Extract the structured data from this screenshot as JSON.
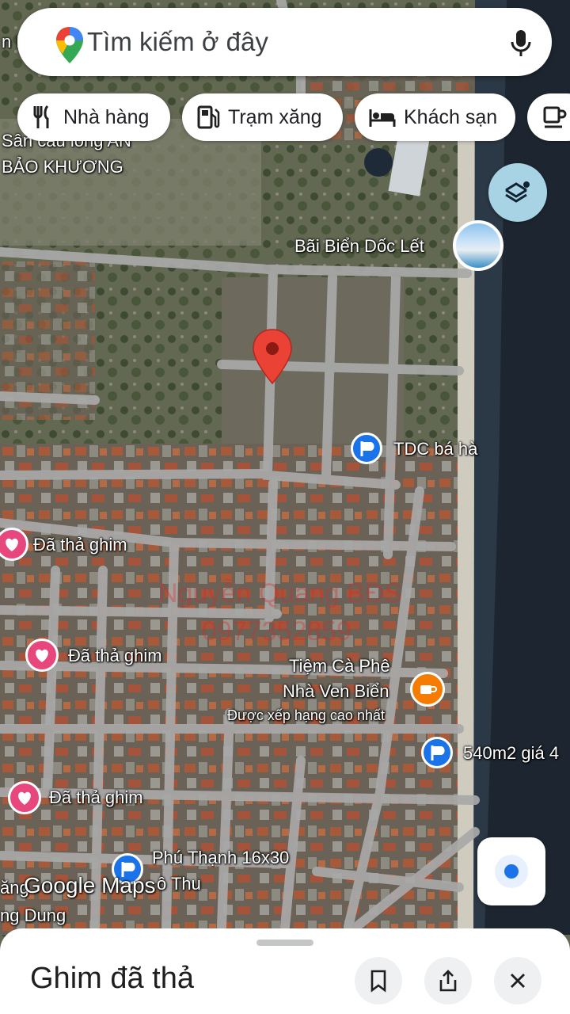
{
  "search": {
    "placeholder": "Tìm kiếm ở đây"
  },
  "chips": [
    {
      "label": "Nhà hàng",
      "icon": "fork-knife-icon"
    },
    {
      "label": "Trạm xăng",
      "icon": "gas-station-icon"
    },
    {
      "label": "Khách sạn",
      "icon": "bed-icon"
    },
    {
      "label": "",
      "icon": "coffee-cup-icon"
    }
  ],
  "map": {
    "labels": {
      "san_cau_long_1": "Sân cầu lông AN",
      "san_cau_long_2": "BẢO KHƯƠNG",
      "bai_bien": "Bãi Biển Dốc Lết",
      "tdc": "TDC bá hà",
      "pin1": "Đã thả ghim",
      "pin2": "Đã thả ghim",
      "pin3": "Đã thả ghim",
      "tiem_ca_phe_1": "Tiệm Cà Phê",
      "tiem_ca_phe_2": "Nhà Ven Biển",
      "xep_hang": "Được xếp hạng cao nhất",
      "lot_540": "540m2 giá 4",
      "phu_thanh": "Phú Thạnh 16x30",
      "thu": "ô Thu",
      "ang": "ăng",
      "ng_dung": "ng Dung",
      "left_top": "n K"
    },
    "watermark": {
      "line1": "Nguyễn Quang BĐS",
      "line2": "0977352859"
    },
    "branding": "Google Maps"
  },
  "sheet": {
    "title": "Ghim đã thả"
  },
  "colors": {
    "accent": "#1a73e8",
    "pin_red": "#ea4335",
    "heart_pink": "#e8477e",
    "coffee_orange": "#f57c00"
  }
}
